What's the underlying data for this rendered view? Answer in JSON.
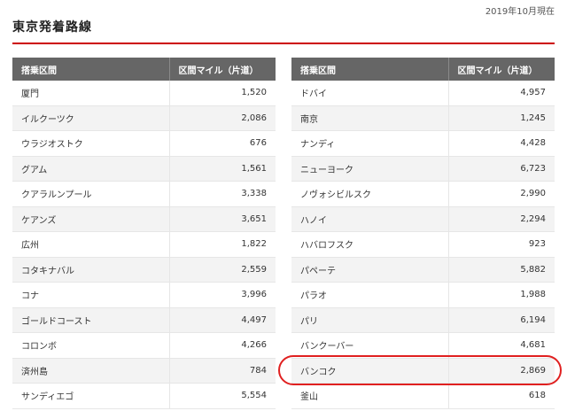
{
  "header": {
    "as_of": "2019年10月現在",
    "title": "東京発着路線"
  },
  "table": {
    "col_route": "搭乗区間",
    "col_miles": "区間マイル（片道）"
  },
  "left_routes": [
    {
      "name": "厦門",
      "miles": "1,520"
    },
    {
      "name": "イルクーツク",
      "miles": "2,086"
    },
    {
      "name": "ウラジオストク",
      "miles": "676"
    },
    {
      "name": "グアム",
      "miles": "1,561"
    },
    {
      "name": "クアラルンプール",
      "miles": "3,338"
    },
    {
      "name": "ケアンズ",
      "miles": "3,651"
    },
    {
      "name": "広州",
      "miles": "1,822"
    },
    {
      "name": "コタキナバル",
      "miles": "2,559"
    },
    {
      "name": "コナ",
      "miles": "3,996"
    },
    {
      "name": "ゴールドコースト",
      "miles": "4,497"
    },
    {
      "name": "コロンボ",
      "miles": "4,266"
    },
    {
      "name": "済州島",
      "miles": "784"
    },
    {
      "name": "サンディエゴ",
      "miles": "5,554"
    }
  ],
  "right_routes": [
    {
      "name": "ドバイ",
      "miles": "4,957"
    },
    {
      "name": "南京",
      "miles": "1,245"
    },
    {
      "name": "ナンディ",
      "miles": "4,428"
    },
    {
      "name": "ニューヨーク",
      "miles": "6,723"
    },
    {
      "name": "ノヴォシビルスク",
      "miles": "2,990"
    },
    {
      "name": "ハノイ",
      "miles": "2,294"
    },
    {
      "name": "ハバロフスク",
      "miles": "923"
    },
    {
      "name": "パペーテ",
      "miles": "5,882"
    },
    {
      "name": "パラオ",
      "miles": "1,988"
    },
    {
      "name": "パリ",
      "miles": "6,194"
    },
    {
      "name": "バンクーバー",
      "miles": "4,681"
    },
    {
      "name": "バンコク",
      "miles": "2,869"
    },
    {
      "name": "釜山",
      "miles": "618"
    }
  ],
  "colors": {
    "accent_rule": "#cc0000",
    "header_bg": "#666666",
    "annotation": "#e02020"
  }
}
